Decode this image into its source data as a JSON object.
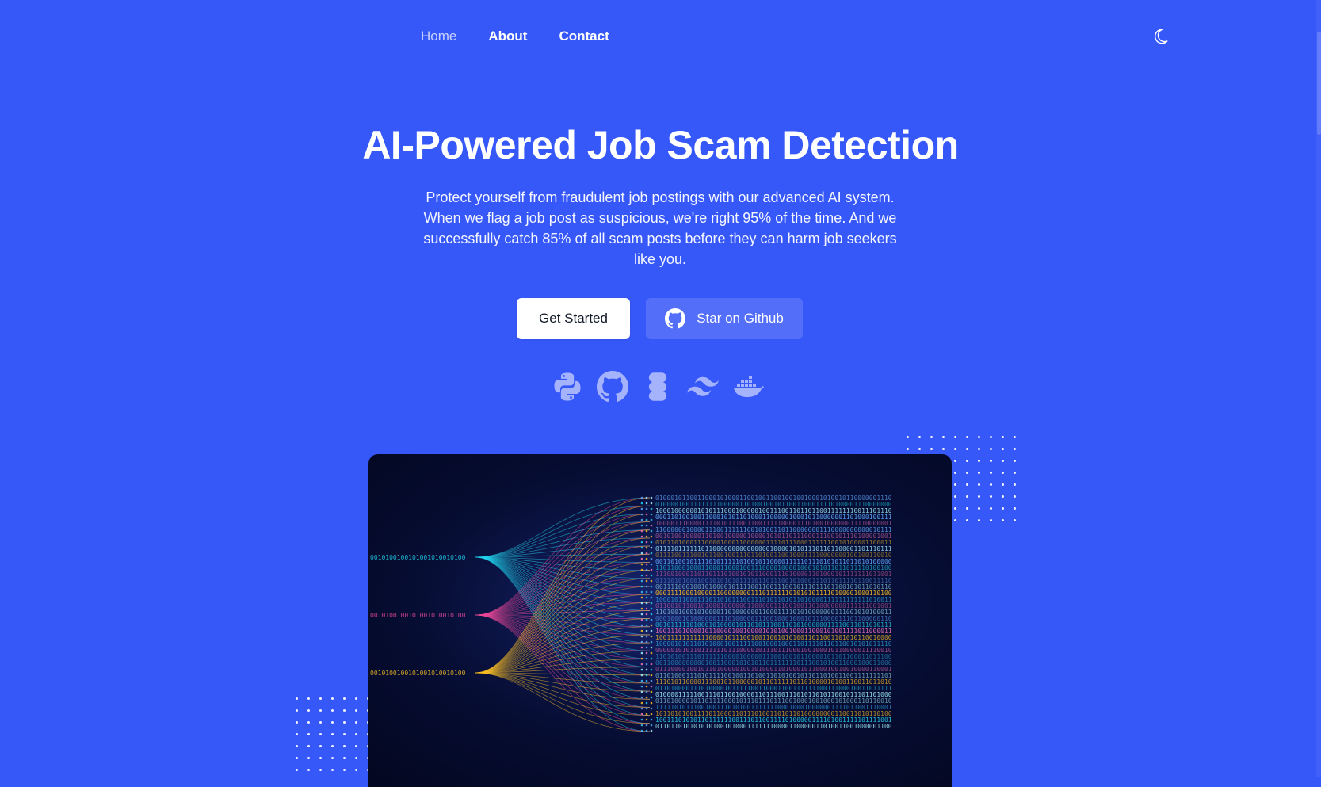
{
  "nav": {
    "items": [
      {
        "label": "Home",
        "active": true
      },
      {
        "label": "About",
        "active": false
      },
      {
        "label": "Contact",
        "active": false
      }
    ],
    "theme_toggle_icon": "moon-icon"
  },
  "hero": {
    "title": "AI-Powered Job Scam Detection",
    "description": "Protect yourself from fraudulent job postings with our advanced AI system. When we flag a job post as suspicious, we're right 95% of the time. And we successfully catch 85% of all scam posts before they can harm job seekers like you.",
    "primary_button": "Get Started",
    "secondary_button": "Star on Github",
    "secondary_button_icon": "github-icon"
  },
  "tech_icons": [
    "python-icon",
    "github-icon",
    "figma-icon",
    "tailwind-icon",
    "docker-icon"
  ],
  "colors": {
    "background": "#3758f9",
    "button_primary_bg": "#ffffff",
    "button_primary_text": "#111928",
    "showcase_bg": "#060d33",
    "stream_cyan": "#22d3ee",
    "stream_pink": "#ec4899",
    "stream_yellow": "#fbbf24"
  }
}
